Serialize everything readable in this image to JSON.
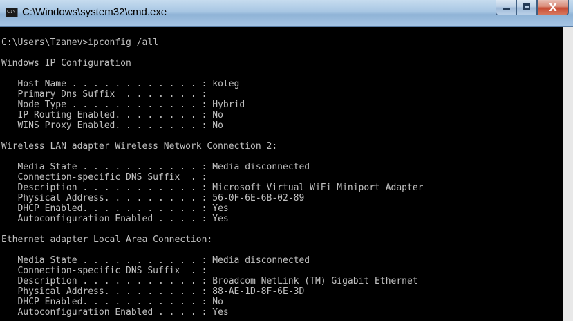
{
  "window": {
    "title": "C:\\Windows\\system32\\cmd.exe",
    "icon": "cmd-console-icon",
    "close_glyph": "X"
  },
  "console": {
    "lines": [
      "",
      "C:\\Users\\Tzanev>ipconfig /all",
      "",
      "Windows IP Configuration",
      "",
      "   Host Name . . . . . . . . . . . . : koleg",
      "   Primary Dns Suffix  . . . . . . . :",
      "   Node Type . . . . . . . . . . . . : Hybrid",
      "   IP Routing Enabled. . . . . . . . : No",
      "   WINS Proxy Enabled. . . . . . . . : No",
      "",
      "Wireless LAN adapter Wireless Network Connection 2:",
      "",
      "   Media State . . . . . . . . . . . : Media disconnected",
      "   Connection-specific DNS Suffix  . :",
      "   Description . . . . . . . . . . . : Microsoft Virtual WiFi Miniport Adapter",
      "   Physical Address. . . . . . . . . : 56-0F-6E-6B-02-89",
      "   DHCP Enabled. . . . . . . . . . . : Yes",
      "   Autoconfiguration Enabled . . . . : Yes",
      "",
      "Ethernet adapter Local Area Connection:",
      "",
      "   Media State . . . . . . . . . . . : Media disconnected",
      "   Connection-specific DNS Suffix  . :",
      "   Description . . . . . . . . . . . : Broadcom NetLink (TM) Gigabit Ethernet",
      "   Physical Address. . . . . . . . . : 88-AE-1D-8F-6E-3D",
      "   DHCP Enabled. . . . . . . . . . . : No",
      "   Autoconfiguration Enabled . . . . : Yes"
    ]
  }
}
